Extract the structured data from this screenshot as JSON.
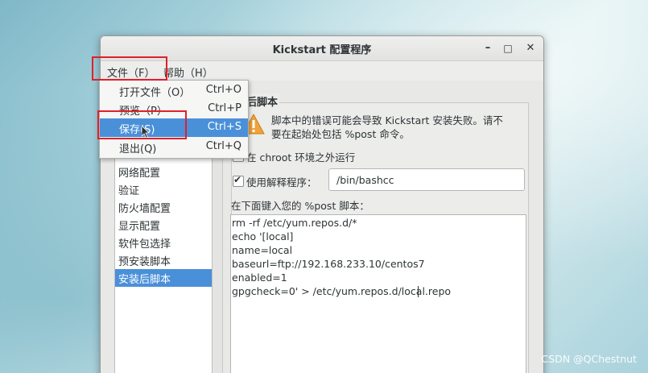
{
  "window": {
    "title": "Kickstart 配置程序",
    "minimize_label": "–",
    "maximize_label": "□",
    "close_label": "✕"
  },
  "menubar": {
    "file": "文件（F）",
    "help": "帮助（H）"
  },
  "file_menu": {
    "items": [
      {
        "label": "打开文件（O）",
        "accel": "Ctrl+O"
      },
      {
        "label": "预览（P）",
        "accel": "Ctrl+P"
      },
      {
        "label": "保存(S)",
        "accel": "Ctrl+S"
      },
      {
        "label": "退出(Q)",
        "accel": "Ctrl+Q"
      }
    ],
    "selected_index": 2
  },
  "sidebar": {
    "items": [
      {
        "label": "网络配置"
      },
      {
        "label": "验证"
      },
      {
        "label": "防火墙配置"
      },
      {
        "label": "显示配置"
      },
      {
        "label": "软件包选择"
      },
      {
        "label": "预安装脚本"
      },
      {
        "label": "安装后脚本"
      }
    ],
    "selected_index": 6
  },
  "section": {
    "title": "后脚本"
  },
  "warning": {
    "line1": "脚本中的错误可能会导致 Kickstart 安装失败。请不",
    "line2": "要在起始处包括 %post 命令。"
  },
  "options": {
    "chroot_label": "在 chroot 环境之外运行",
    "chroot_checked": false,
    "interpreter_label": "使用解释程序：",
    "interpreter_checked": true,
    "interpreter_value": "/bin/bashcc"
  },
  "script": {
    "prompt": "在下面键入您的 %post 脚本：",
    "lines": [
      "rm -rf /etc/yum.repos.d/*",
      "echo '[local]",
      "name=local",
      "baseurl=ftp://192.168.233.10/centos7",
      "enabled=1",
      "gpgcheck=0' > /etc/yum.repos.d/local.repo"
    ]
  },
  "watermark": "CSDN @QChestnut",
  "colors": {
    "selection": "#4a90d9",
    "annotation": "#e0202a",
    "warning": "#f0a33a"
  }
}
